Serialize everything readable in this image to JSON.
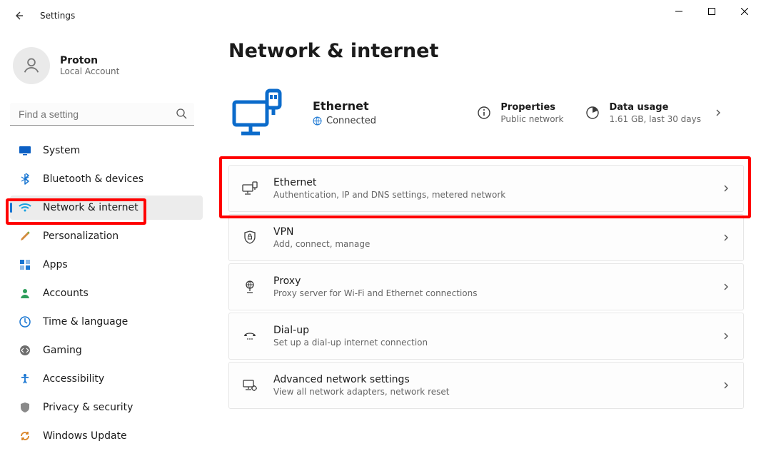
{
  "app_title": "Settings",
  "user": {
    "name": "Proton",
    "sub": "Local Account"
  },
  "search_placeholder": "Find a setting",
  "nav": [
    {
      "key": "system",
      "label": "System"
    },
    {
      "key": "bt",
      "label": "Bluetooth & devices"
    },
    {
      "key": "net",
      "label": "Network & internet",
      "active": true
    },
    {
      "key": "pers",
      "label": "Personalization"
    },
    {
      "key": "apps",
      "label": "Apps"
    },
    {
      "key": "acct",
      "label": "Accounts"
    },
    {
      "key": "time",
      "label": "Time & language"
    },
    {
      "key": "gaming",
      "label": "Gaming"
    },
    {
      "key": "access",
      "label": "Accessibility"
    },
    {
      "key": "privacy",
      "label": "Privacy & security"
    },
    {
      "key": "update",
      "label": "Windows Update"
    }
  ],
  "page_title": "Network & internet",
  "status": {
    "name": "Ethernet",
    "state": "Connected",
    "meta": [
      {
        "title": "Properties",
        "sub": "Public network"
      },
      {
        "title": "Data usage",
        "sub": "1.61 GB, last 30 days"
      }
    ]
  },
  "cards": [
    {
      "key": "ethernet",
      "title": "Ethernet",
      "sub": "Authentication, IP and DNS settings, metered network"
    },
    {
      "key": "vpn",
      "title": "VPN",
      "sub": "Add, connect, manage"
    },
    {
      "key": "proxy",
      "title": "Proxy",
      "sub": "Proxy server for Wi-Fi and Ethernet connections"
    },
    {
      "key": "dialup",
      "title": "Dial-up",
      "sub": "Set up a dial-up internet connection"
    },
    {
      "key": "advanced",
      "title": "Advanced network settings",
      "sub": "View all network adapters, network reset"
    }
  ]
}
